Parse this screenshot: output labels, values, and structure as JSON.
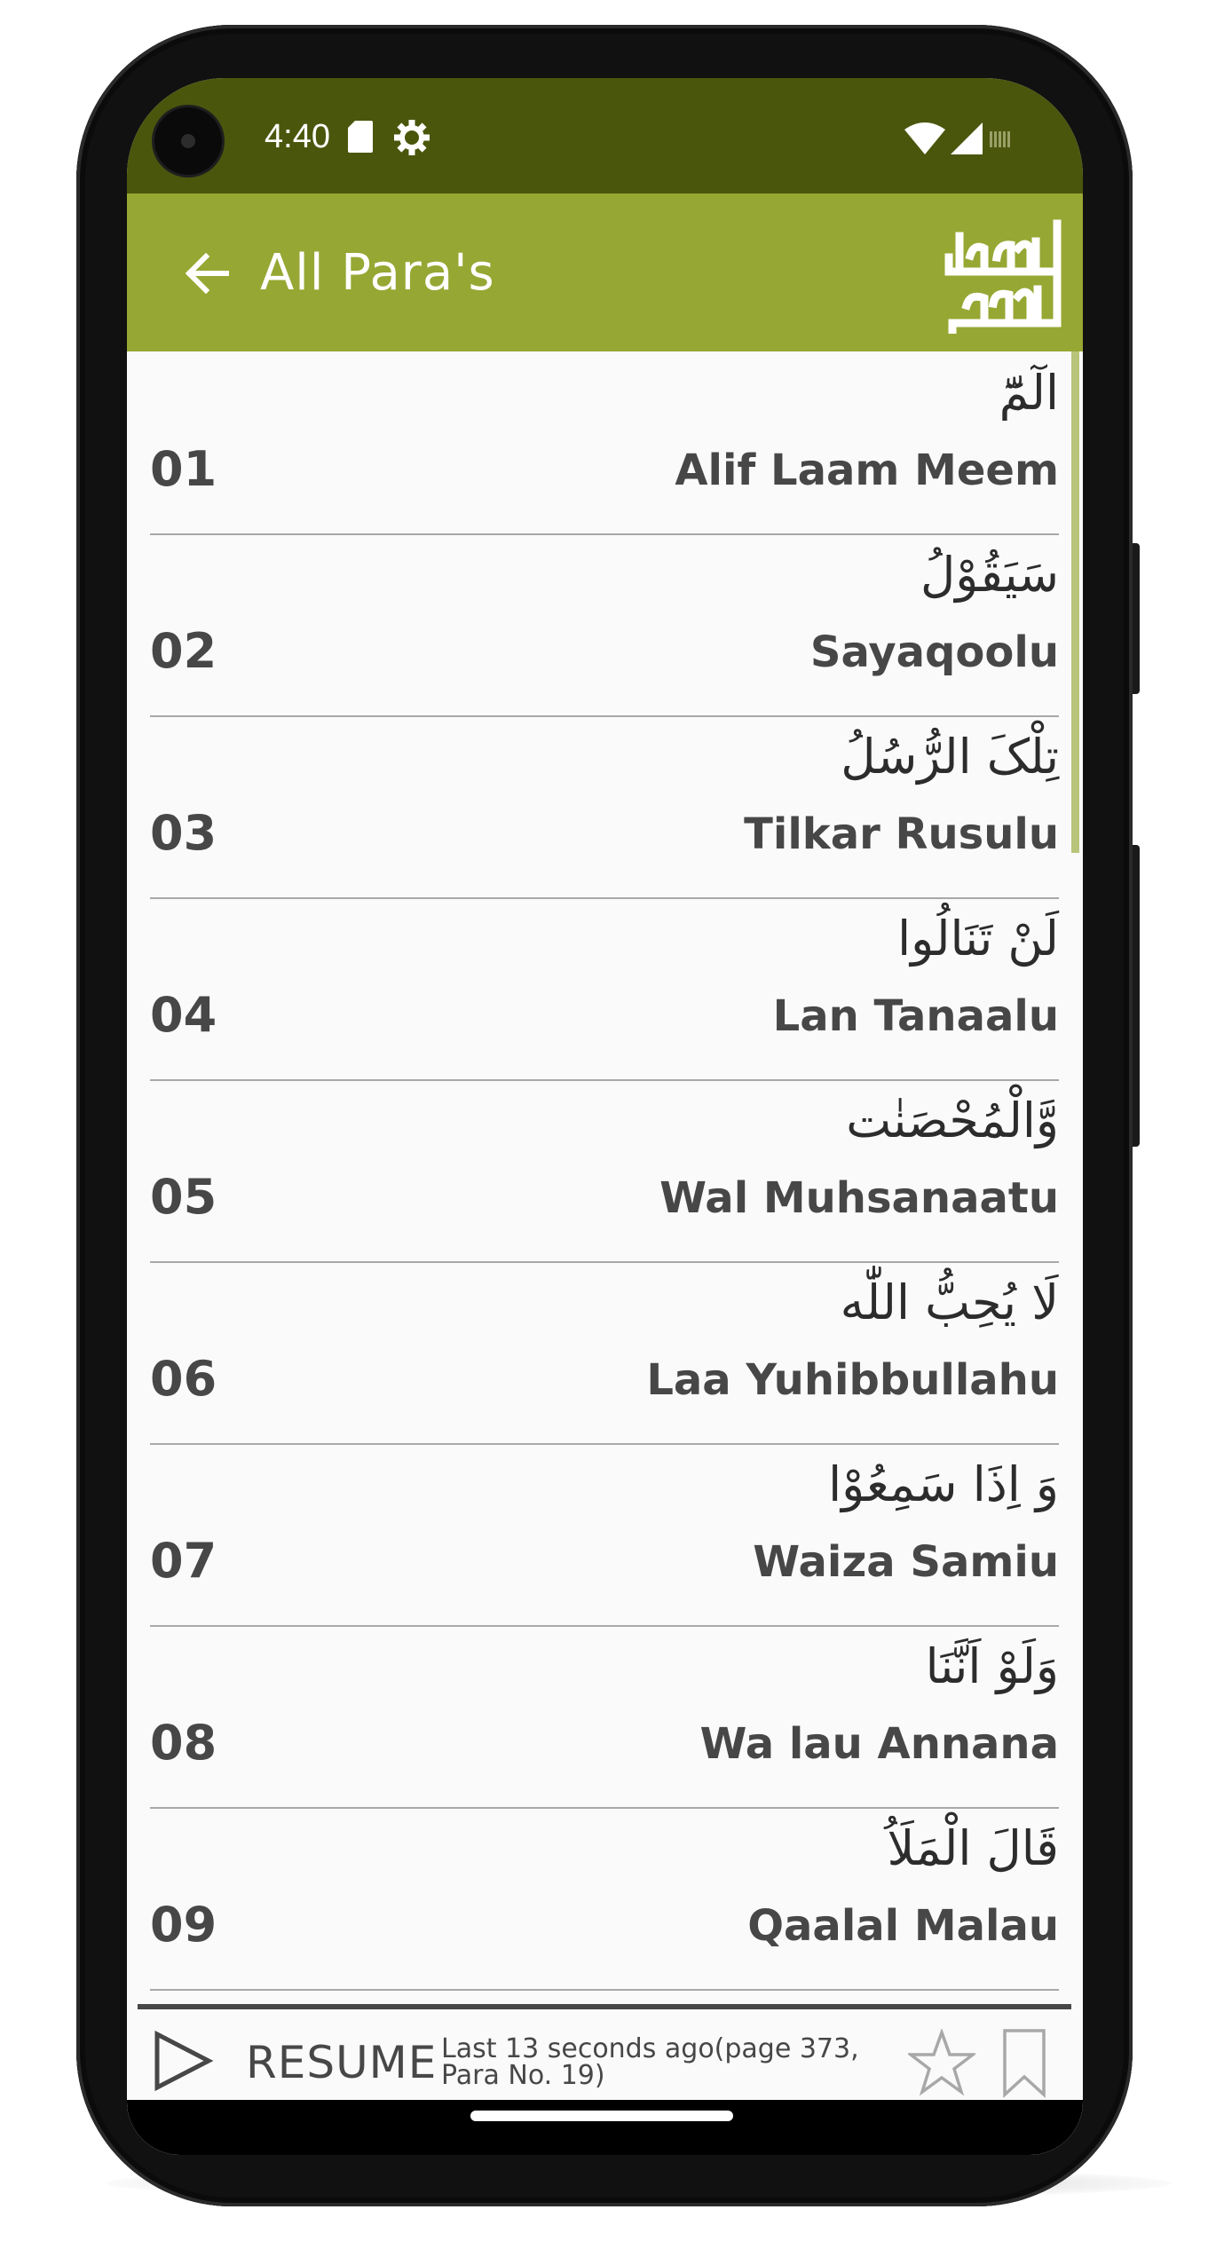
{
  "status_bar": {
    "time": "4:40",
    "icons": [
      "sd-card-icon",
      "settings-gear-icon",
      "wifi-icon",
      "signal-icon",
      "battery-icon"
    ]
  },
  "toolbar": {
    "title": "All Para's",
    "back_icon": "arrow-left-icon",
    "logo": "القرآن الكريم"
  },
  "paras": [
    {
      "number": "01",
      "arabic": "الٓمّٓ",
      "name": "Alif Laam Meem"
    },
    {
      "number": "02",
      "arabic": "سَيَقُوْلُ",
      "name": "Sayaqoolu"
    },
    {
      "number": "03",
      "arabic": "تِلْکَ الرُّسُلُ",
      "name": "Tilkar Rusulu"
    },
    {
      "number": "04",
      "arabic": "لَنْ تَنَالُوا",
      "name": "Lan Tanaalu"
    },
    {
      "number": "05",
      "arabic": "وَّالْمُحْصَنٰت",
      "name": "Wal Muhsanaatu"
    },
    {
      "number": "06",
      "arabic": "لَا يُحِبُّ اللّٰه",
      "name": "Laa Yuhibbullahu"
    },
    {
      "number": "07",
      "arabic": "وَ اِذَا سَمِعُوْا",
      "name": "Waiza Samiu"
    },
    {
      "number": "08",
      "arabic": "وَلَوْ اَنَّنَا",
      "name": "Wa lau Annana"
    },
    {
      "number": "09",
      "arabic": "قَالَ الْمَلَاُ",
      "name": "Qaalal Malau"
    }
  ],
  "resume_bar": {
    "label": "RESUME",
    "info_line1": "Last 13 seconds ago(page 373,",
    "info_line2": "Para No. 19)",
    "icons": [
      "play-icon",
      "star-icon",
      "bookmark-icon"
    ]
  },
  "colors": {
    "status_bar": "#4b560d",
    "toolbar": "#97a733",
    "text": "#474747",
    "list_background": "#fafafa"
  }
}
